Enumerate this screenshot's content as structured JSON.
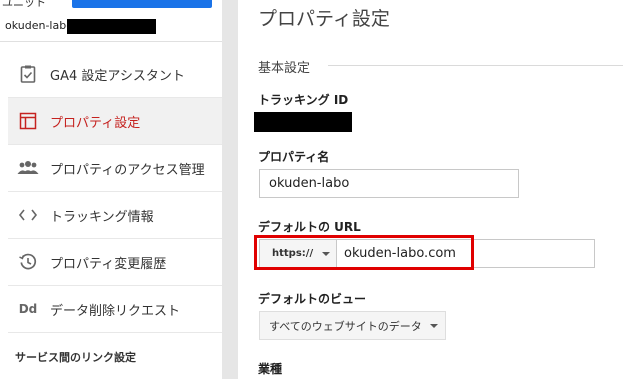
{
  "sidebar": {
    "top_cut_label": "ユニット",
    "account_name": "okuden-labo",
    "items": [
      {
        "label": "GA4 設定アシスタント",
        "icon": "clipboard-check-icon",
        "active": false
      },
      {
        "label": "プロパティ設定",
        "icon": "layout-window-icon",
        "active": true
      },
      {
        "label": "プロパティのアクセス管理",
        "icon": "people-group-icon",
        "active": false
      },
      {
        "label": "トラッキング情報",
        "icon": "code-brackets-icon",
        "active": false
      },
      {
        "label": "プロパティ変更履歴",
        "icon": "history-clock-icon",
        "active": false
      },
      {
        "label": "データ削除リクエスト",
        "icon": "dd-letters-icon",
        "active": false
      }
    ],
    "section_label": "サービス間のリンク設定"
  },
  "main": {
    "title": "プロパティ設定",
    "section_title": "基本設定",
    "tracking_id_label": "トラッキング ID",
    "property_name_label": "プロパティ名",
    "property_name_value": "okuden-labo",
    "default_url_label": "デフォルトの URL",
    "protocol_value": "https://",
    "url_value": "okuden-labo.com",
    "default_view_label": "デフォルトのビュー",
    "default_view_value": "すべてのウェブサイトのデータ",
    "industry_label": "業種"
  },
  "colors": {
    "active_text": "#c5221f",
    "highlight_border": "#e00000",
    "primary_button": "#1a73e8"
  }
}
